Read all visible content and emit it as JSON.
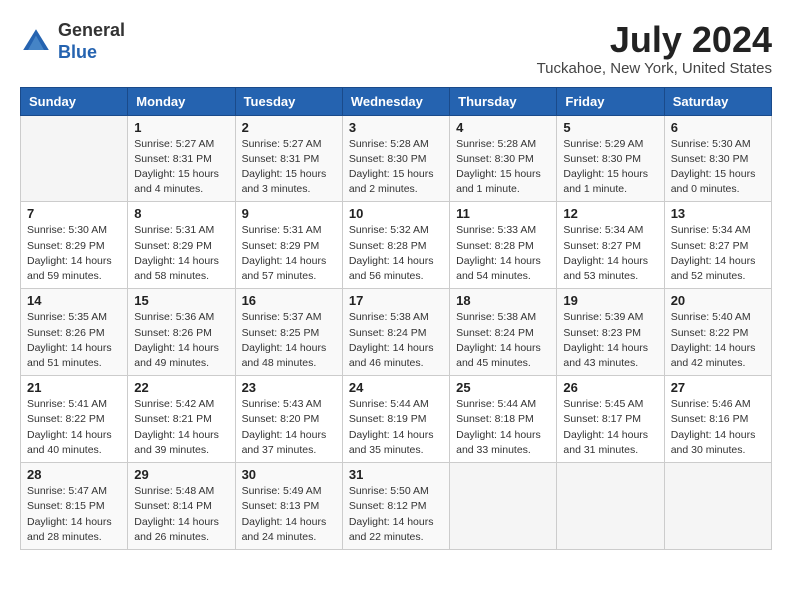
{
  "header": {
    "logo_line1": "General",
    "logo_line2": "Blue",
    "month": "July 2024",
    "location": "Tuckahoe, New York, United States"
  },
  "weekdays": [
    "Sunday",
    "Monday",
    "Tuesday",
    "Wednesday",
    "Thursday",
    "Friday",
    "Saturday"
  ],
  "weeks": [
    [
      {
        "day": "",
        "info": ""
      },
      {
        "day": "1",
        "info": "Sunrise: 5:27 AM\nSunset: 8:31 PM\nDaylight: 15 hours\nand 4 minutes."
      },
      {
        "day": "2",
        "info": "Sunrise: 5:27 AM\nSunset: 8:31 PM\nDaylight: 15 hours\nand 3 minutes."
      },
      {
        "day": "3",
        "info": "Sunrise: 5:28 AM\nSunset: 8:30 PM\nDaylight: 15 hours\nand 2 minutes."
      },
      {
        "day": "4",
        "info": "Sunrise: 5:28 AM\nSunset: 8:30 PM\nDaylight: 15 hours\nand 1 minute."
      },
      {
        "day": "5",
        "info": "Sunrise: 5:29 AM\nSunset: 8:30 PM\nDaylight: 15 hours\nand 1 minute."
      },
      {
        "day": "6",
        "info": "Sunrise: 5:30 AM\nSunset: 8:30 PM\nDaylight: 15 hours\nand 0 minutes."
      }
    ],
    [
      {
        "day": "7",
        "info": "Sunrise: 5:30 AM\nSunset: 8:29 PM\nDaylight: 14 hours\nand 59 minutes."
      },
      {
        "day": "8",
        "info": "Sunrise: 5:31 AM\nSunset: 8:29 PM\nDaylight: 14 hours\nand 58 minutes."
      },
      {
        "day": "9",
        "info": "Sunrise: 5:31 AM\nSunset: 8:29 PM\nDaylight: 14 hours\nand 57 minutes."
      },
      {
        "day": "10",
        "info": "Sunrise: 5:32 AM\nSunset: 8:28 PM\nDaylight: 14 hours\nand 56 minutes."
      },
      {
        "day": "11",
        "info": "Sunrise: 5:33 AM\nSunset: 8:28 PM\nDaylight: 14 hours\nand 54 minutes."
      },
      {
        "day": "12",
        "info": "Sunrise: 5:34 AM\nSunset: 8:27 PM\nDaylight: 14 hours\nand 53 minutes."
      },
      {
        "day": "13",
        "info": "Sunrise: 5:34 AM\nSunset: 8:27 PM\nDaylight: 14 hours\nand 52 minutes."
      }
    ],
    [
      {
        "day": "14",
        "info": "Sunrise: 5:35 AM\nSunset: 8:26 PM\nDaylight: 14 hours\nand 51 minutes."
      },
      {
        "day": "15",
        "info": "Sunrise: 5:36 AM\nSunset: 8:26 PM\nDaylight: 14 hours\nand 49 minutes."
      },
      {
        "day": "16",
        "info": "Sunrise: 5:37 AM\nSunset: 8:25 PM\nDaylight: 14 hours\nand 48 minutes."
      },
      {
        "day": "17",
        "info": "Sunrise: 5:38 AM\nSunset: 8:24 PM\nDaylight: 14 hours\nand 46 minutes."
      },
      {
        "day": "18",
        "info": "Sunrise: 5:38 AM\nSunset: 8:24 PM\nDaylight: 14 hours\nand 45 minutes."
      },
      {
        "day": "19",
        "info": "Sunrise: 5:39 AM\nSunset: 8:23 PM\nDaylight: 14 hours\nand 43 minutes."
      },
      {
        "day": "20",
        "info": "Sunrise: 5:40 AM\nSunset: 8:22 PM\nDaylight: 14 hours\nand 42 minutes."
      }
    ],
    [
      {
        "day": "21",
        "info": "Sunrise: 5:41 AM\nSunset: 8:22 PM\nDaylight: 14 hours\nand 40 minutes."
      },
      {
        "day": "22",
        "info": "Sunrise: 5:42 AM\nSunset: 8:21 PM\nDaylight: 14 hours\nand 39 minutes."
      },
      {
        "day": "23",
        "info": "Sunrise: 5:43 AM\nSunset: 8:20 PM\nDaylight: 14 hours\nand 37 minutes."
      },
      {
        "day": "24",
        "info": "Sunrise: 5:44 AM\nSunset: 8:19 PM\nDaylight: 14 hours\nand 35 minutes."
      },
      {
        "day": "25",
        "info": "Sunrise: 5:44 AM\nSunset: 8:18 PM\nDaylight: 14 hours\nand 33 minutes."
      },
      {
        "day": "26",
        "info": "Sunrise: 5:45 AM\nSunset: 8:17 PM\nDaylight: 14 hours\nand 31 minutes."
      },
      {
        "day": "27",
        "info": "Sunrise: 5:46 AM\nSunset: 8:16 PM\nDaylight: 14 hours\nand 30 minutes."
      }
    ],
    [
      {
        "day": "28",
        "info": "Sunrise: 5:47 AM\nSunset: 8:15 PM\nDaylight: 14 hours\nand 28 minutes."
      },
      {
        "day": "29",
        "info": "Sunrise: 5:48 AM\nSunset: 8:14 PM\nDaylight: 14 hours\nand 26 minutes."
      },
      {
        "day": "30",
        "info": "Sunrise: 5:49 AM\nSunset: 8:13 PM\nDaylight: 14 hours\nand 24 minutes."
      },
      {
        "day": "31",
        "info": "Sunrise: 5:50 AM\nSunset: 8:12 PM\nDaylight: 14 hours\nand 22 minutes."
      },
      {
        "day": "",
        "info": ""
      },
      {
        "day": "",
        "info": ""
      },
      {
        "day": "",
        "info": ""
      }
    ]
  ]
}
